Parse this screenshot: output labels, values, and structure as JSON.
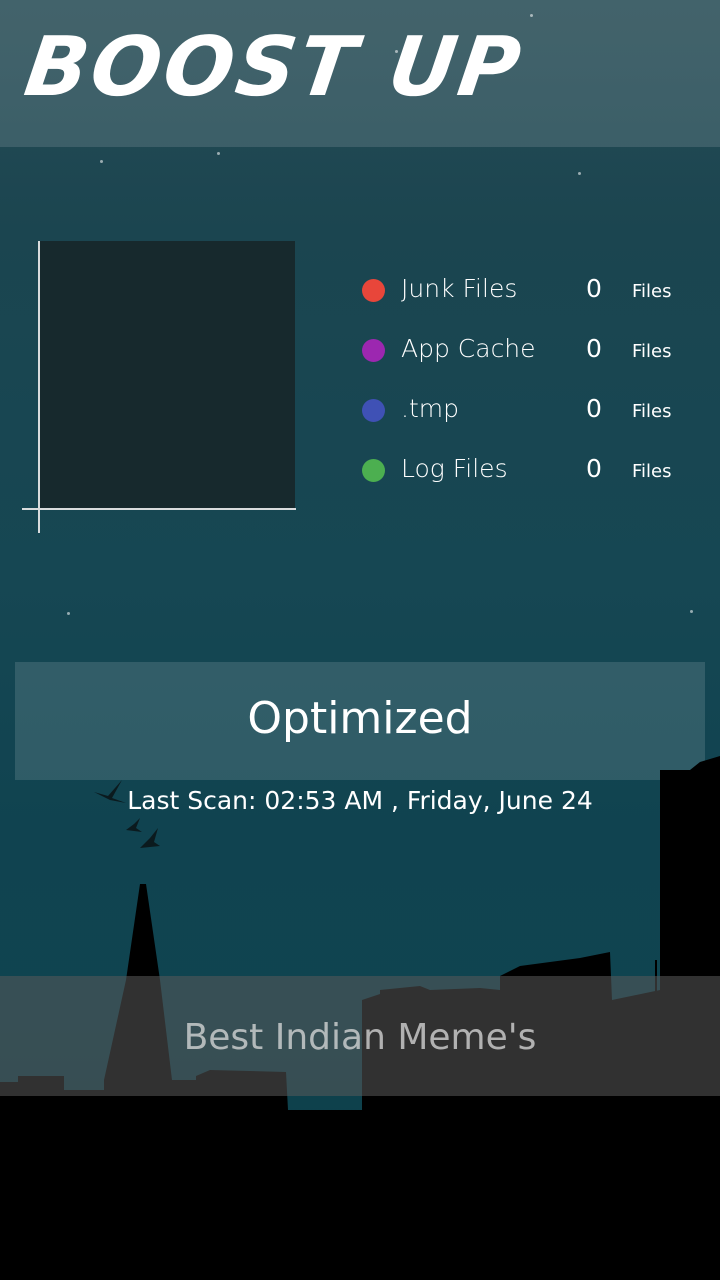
{
  "app": {
    "title": "BOOST UP"
  },
  "legend": [
    {
      "label": "Junk Files",
      "count": "0",
      "unit": "Files",
      "color": "#e8463a"
    },
    {
      "label": "App Cache",
      "count": "0",
      "unit": "Files",
      "color": "#9c27b0"
    },
    {
      "label": ".tmp",
      "count": "0",
      "unit": "Files",
      "color": "#3f51b5"
    },
    {
      "label": "Log Files",
      "count": "0",
      "unit": "Files",
      "color": "#4caf50"
    }
  ],
  "status": {
    "text": "Optimized",
    "last_scan": "Last Scan: 02:53 AM , Friday, June 24"
  },
  "banner": {
    "text": "Best Indian Meme's"
  },
  "colors": {
    "background": "#164753",
    "panel_overlay": "rgba(255,255,255,0.13)",
    "chart_area": "#17292d"
  }
}
